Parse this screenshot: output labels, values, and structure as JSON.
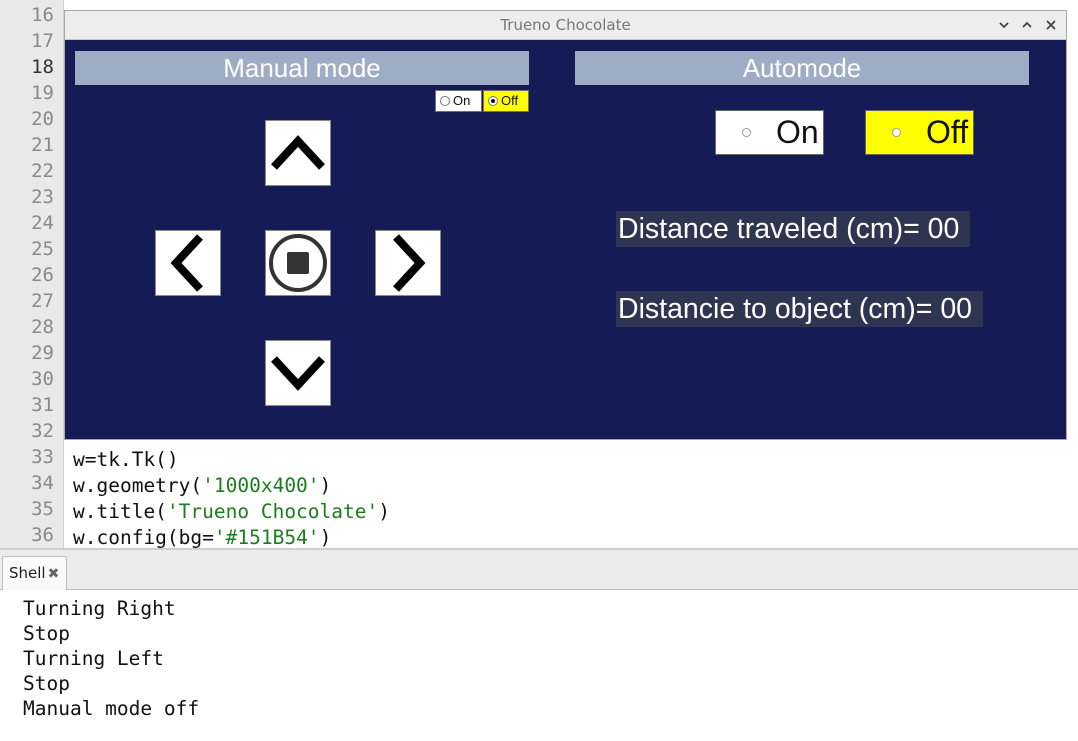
{
  "editor": {
    "line_numbers": [
      "16",
      "17",
      "18",
      "19",
      "20",
      "21",
      "22",
      "23",
      "24",
      "25",
      "26",
      "27",
      "28",
      "29",
      "30",
      "31",
      "32",
      "33",
      "34",
      "35",
      "36"
    ],
    "current_line": "18",
    "code_lines": [
      {
        "prefix": "w=tk.Tk()",
        "string": "",
        "suffix": ""
      },
      {
        "prefix": "w.geometry(",
        "string": "'1000x400'",
        "suffix": ")"
      },
      {
        "prefix": "w.title(",
        "string": "'Trueno Chocolate'",
        "suffix": ")"
      },
      {
        "prefix": "w.config(bg=",
        "string": "'#151B54'",
        "suffix": ")"
      }
    ]
  },
  "window": {
    "title": "Trueno Chocolate",
    "controls": [
      "minimize-icon",
      "maximize-icon",
      "close-icon"
    ],
    "background": "#151B54"
  },
  "manual": {
    "header": "Manual mode",
    "on_label": "On",
    "off_label": "Off",
    "selected": "Off",
    "buttons": [
      "up-arrow-icon",
      "left-arrow-icon",
      "stop-icon",
      "right-arrow-icon",
      "down-arrow-icon"
    ]
  },
  "auto": {
    "header": "Automode",
    "on_label": "On",
    "off_label": "Off",
    "selected": "Off"
  },
  "readouts": {
    "distance_traveled": "Distance traveled (cm)= 00",
    "distance_object": "Distancie to object (cm)= 00"
  },
  "colors": {
    "header_bg": "#9eadc5",
    "selected_bg": "#ffff00",
    "readout_bg": "#2e3550"
  },
  "shell": {
    "tab_label": "Shell",
    "lines": [
      "Turning Right",
      "Stop",
      "Turning Left",
      "Stop",
      "Manual mode off"
    ]
  }
}
